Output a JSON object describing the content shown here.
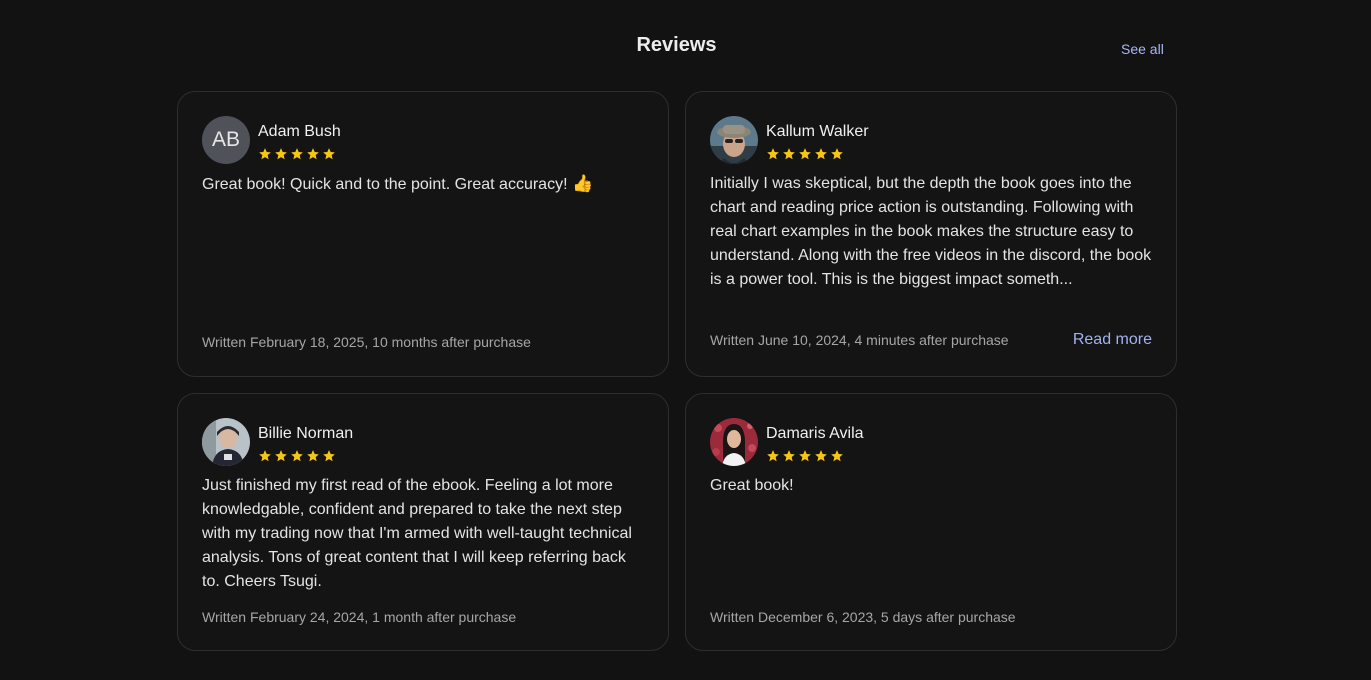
{
  "header": {
    "title": "Reviews",
    "see_all": "See all"
  },
  "colors": {
    "star": "#f5c518",
    "link": "#a0b2f2",
    "background": "#121212",
    "card_border": "#2e2e2e"
  },
  "reviews": [
    {
      "name": "Adam Bush",
      "initials": "AB",
      "rating": 5,
      "text": "Great book! Quick and to the point. Great accuracy!",
      "emoji": "👍",
      "written": "Written February 18, 2025, 10 months after purchase"
    },
    {
      "name": "Kallum Walker",
      "rating": 5,
      "text": "Initially I was skeptical, but the depth the book goes into the chart and reading price action is outstanding. Following with real chart examples in the book makes the structure easy to understand. Along with the free videos in the discord, the book is a power tool. This is the biggest impact someth...",
      "written": "Written June 10, 2024, 4 minutes after purchase",
      "read_more": "Read more"
    },
    {
      "name": "Billie Norman",
      "rating": 5,
      "text": "Just finished my first read of the ebook. Feeling a lot more knowledgable, confident and prepared to take the next step with my trading now that I'm armed with well-taught technical analysis. Tons of great content that I will keep referring back to. Cheers Tsugi.",
      "written": "Written February 24, 2024, 1 month after purchase"
    },
    {
      "name": "Damaris Avila",
      "rating": 5,
      "text": "Great book!",
      "written": "Written December 6, 2023, 5 days after purchase"
    }
  ]
}
